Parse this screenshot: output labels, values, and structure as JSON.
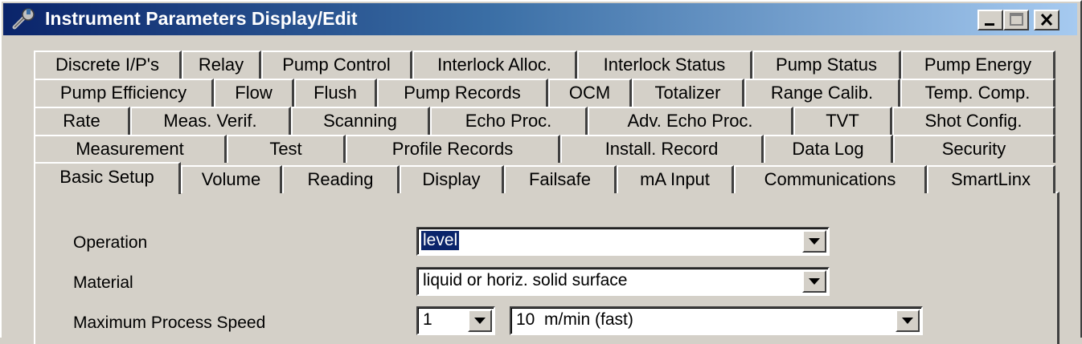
{
  "window": {
    "title": "Instrument Parameters Display/Edit"
  },
  "tabs": {
    "row1": [
      "Discrete I/P's",
      "Relay",
      "Pump Control",
      "Interlock Alloc.",
      "Interlock Status",
      "Pump Status",
      "Pump Energy"
    ],
    "row2": [
      "Pump Efficiency",
      "Flow",
      "Flush",
      "Pump Records",
      "OCM",
      "Totalizer",
      "Range Calib.",
      "Temp. Comp."
    ],
    "row3": [
      "Rate",
      "Meas. Verif.",
      "Scanning",
      "Echo Proc.",
      "Adv. Echo Proc.",
      "TVT",
      "Shot Config."
    ],
    "row4": [
      "Measurement",
      "Test",
      "Profile Records",
      "Install. Record",
      "Data Log",
      "Security"
    ],
    "row5": [
      "Basic Setup",
      "Volume",
      "Reading",
      "Display",
      "Failsafe",
      "mA Input",
      "Communications",
      "SmartLinx"
    ],
    "active": "Basic Setup"
  },
  "form": {
    "operation": {
      "label": "Operation",
      "value": "level"
    },
    "material": {
      "label": "Material",
      "value": "liquid or horiz. solid surface"
    },
    "speed": {
      "label": "Maximum Process Speed",
      "point": "1",
      "value": "10  m/min (fast)"
    }
  },
  "icons": {
    "title": "wrench-icon",
    "dropdown": "chevron-down-icon"
  }
}
